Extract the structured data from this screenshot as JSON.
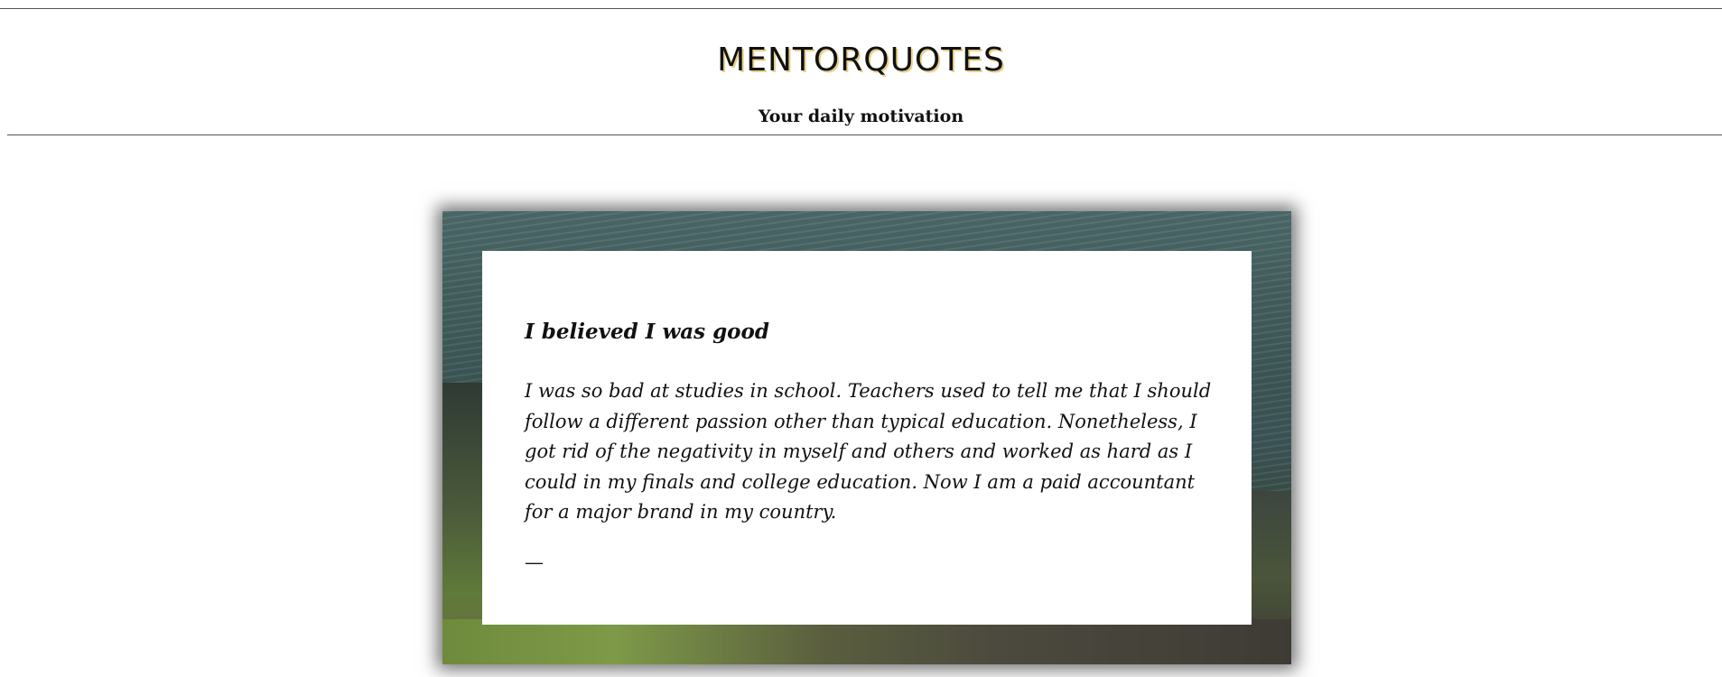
{
  "header": {
    "title": "MENTORQUOTES",
    "tagline": "Your daily motivation"
  },
  "quote": {
    "title": "I believed I was good",
    "body": "I was so bad at studies in school. Teachers used to tell me that I should follow a different passion other than typical education. Nonetheless, I got rid of the negativity in myself and others and worked as hard as I could in my finals and college education. Now I am a paid accountant for a major brand in my country.",
    "author_dash": "—"
  },
  "colors": {
    "title_shadow": "#e8d08a",
    "text": "#111111",
    "rule": "#555555",
    "card_background_top": "#4e6a6a",
    "card_background_bottom": "#4a4638"
  }
}
